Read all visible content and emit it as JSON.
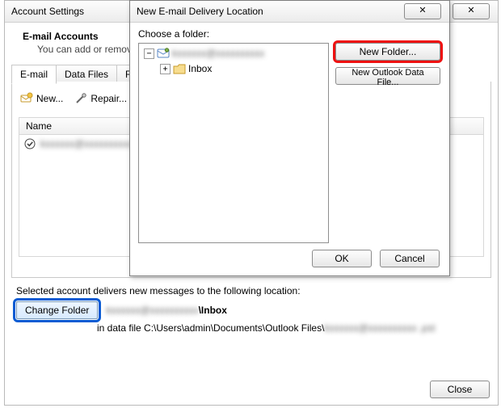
{
  "account_settings": {
    "title": "Account Settings",
    "close_x": "✕",
    "header_title": "E-mail Accounts",
    "header_sub": "You can add or remov",
    "tabs": [
      "E-mail",
      "Data Files",
      "RSS Fe"
    ],
    "toolbar": {
      "new": "New...",
      "repair": "Repair..."
    },
    "list": {
      "header": "Name",
      "row_account": "kxxxxxx@xxxxxxxxxx"
    },
    "lower": {
      "line": "Selected account delivers new messages to the following location:",
      "change_folder": "Change Folder",
      "path_prefix_blur": "kxxxxxx@xxxxxxxxxx",
      "path_suffix": "\\Inbox",
      "datafile_prefix": "in data file C:\\Users\\admin\\Documents\\Outlook Files\\",
      "datafile_blur": "kxxxxxx@xxxxxxxxxx .pst"
    },
    "close_btn": "Close"
  },
  "dialog": {
    "title": "New E-mail Delivery Location",
    "close_x": "✕",
    "label": "Choose a folder:",
    "tree": {
      "root_blur": "kxxxxxx@xxxxxxxxxx",
      "inbox": "Inbox"
    },
    "new_folder": "New Folder...",
    "new_datafile": "New Outlook Data File...",
    "ok": "OK",
    "cancel": "Cancel"
  },
  "icons": {
    "minus": "−",
    "plus": "+"
  }
}
